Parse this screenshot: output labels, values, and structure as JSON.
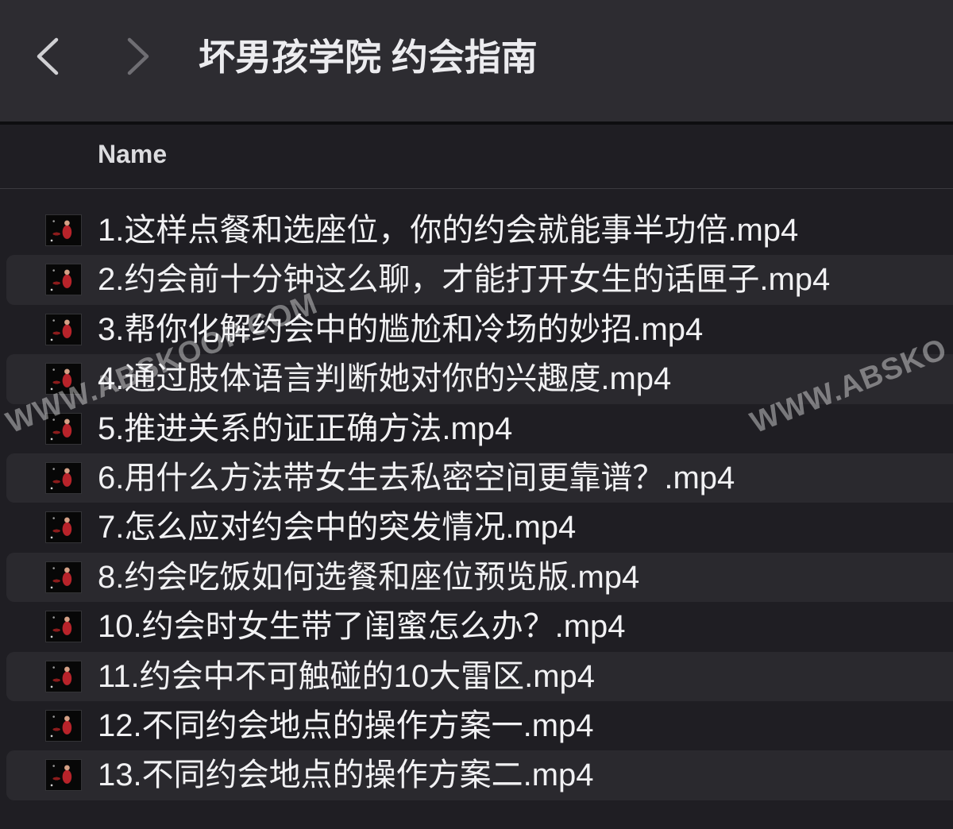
{
  "window": {
    "title": "坏男孩学院 约会指南"
  },
  "toolbar": {
    "back_icon": "chevron-left-icon",
    "forward_icon": "chevron-right-icon",
    "forward_enabled": false
  },
  "list": {
    "column_name": "Name",
    "file_icon": "video-thumbnail",
    "files": [
      {
        "name": "1.这样点餐和选座位，你的约会就能事半功倍.mp4"
      },
      {
        "name": "2.约会前十分钟这么聊，才能打开女生的话匣子.mp4"
      },
      {
        "name": "3.帮你化解约会中的尴尬和冷场的妙招.mp4"
      },
      {
        "name": "4.通过肢体语言判断她对你的兴趣度.mp4"
      },
      {
        "name": "5.推进关系的证正确方法.mp4"
      },
      {
        "name": "6.用什么方法带女生去私密空间更靠谱？.mp4"
      },
      {
        "name": "7.怎么应对约会中的突发情况.mp4"
      },
      {
        "name": "8.约会吃饭如何选餐和座位预览版.mp4"
      },
      {
        "name": "10.约会时女生带了闺蜜怎么办？.mp4"
      },
      {
        "name": "11.约会中不可触碰的10大雷区.mp4"
      },
      {
        "name": "12.不同约会地点的操作方案一.mp4"
      },
      {
        "name": "13.不同约会地点的操作方案二.mp4"
      }
    ]
  },
  "watermark": {
    "center": "WWW.ABSKOOP.COM",
    "right": "WWW.ABSKO"
  },
  "colors": {
    "toolbar_bg": "#2d2c31",
    "list_bg": "#1f1e23",
    "alt_row_bg": "#2a292e",
    "text": "#f1f1f3",
    "nav_active": "#d0d0d3",
    "nav_disabled": "#6f6e73"
  }
}
